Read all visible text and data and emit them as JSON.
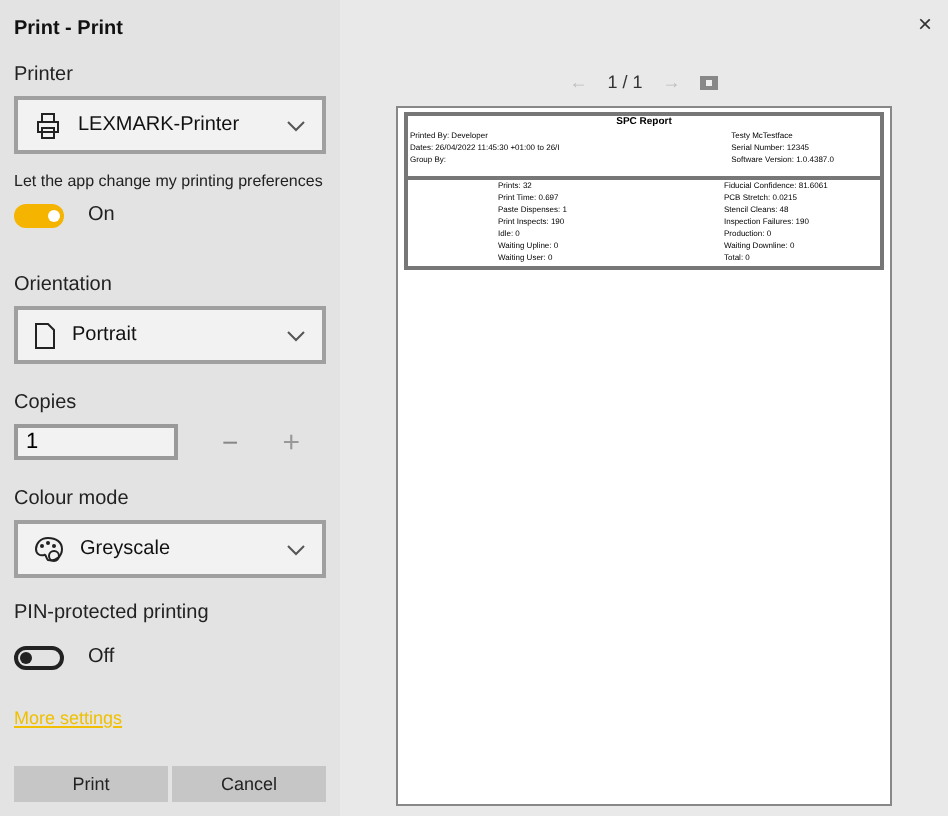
{
  "window": {
    "title": "Print - Print",
    "close": "×"
  },
  "printer": {
    "label": "Printer",
    "value": "LEXMARK-Printer"
  },
  "app_preferences": {
    "label": "Let the app change my printing preferences",
    "on": true,
    "state_text": "On"
  },
  "orientation": {
    "label": "Orientation",
    "value": "Portrait"
  },
  "copies": {
    "label": "Copies",
    "value": "1",
    "minus": "−",
    "plus": "+"
  },
  "colour_mode": {
    "label": "Colour mode",
    "value": "Greyscale"
  },
  "pin_printing": {
    "label": "PIN-protected printing",
    "on": false,
    "state_text": "Off"
  },
  "more_settings": "More settings",
  "buttons": [
    "Print",
    "Cancel"
  ],
  "preview_nav": {
    "prev": "←",
    "page": "1 / 1",
    "next": "→"
  },
  "report": {
    "title": "SPC Report",
    "header_left": [
      "Printed By: Developer",
      "Dates: 26/04/2022 11:45:30 +01:00 to 26/I",
      "Group By:"
    ],
    "header_right": [
      "Testy McTestface",
      "Serial Number: 12345",
      "Software Version: 1.0.4387.0"
    ],
    "stats_left": [
      "Prints: 32",
      "Print Time: 0.697",
      "Paste Dispenses: 1",
      "Print Inspects: 190",
      "Idle: 0",
      "Waiting Upline: 0",
      "Waiting User: 0"
    ],
    "stats_right": [
      "Fiducial Confidence: 81.6061",
      "PCB Stretch: 0.0215",
      "Stencil Cleans: 48",
      "Inspection Failures: 190",
      "Production: 0",
      "Waiting Downline: 0",
      "Total: 0"
    ]
  }
}
